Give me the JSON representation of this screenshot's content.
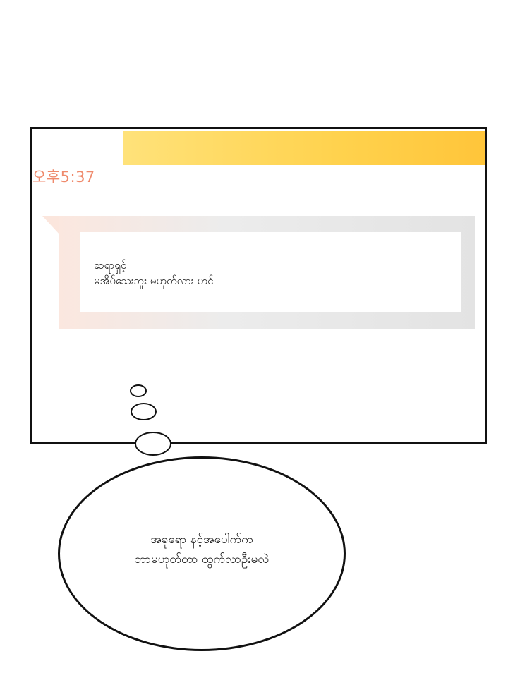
{
  "chat_panel": {
    "time": "오후5:37",
    "message_lines": [
      "ဆရာရှင့်",
      "မအိပ်သေးဘူး မဟုတ်လား ဟင်"
    ]
  },
  "thought": {
    "lines": [
      "အခုရော နင့်အပေါက်က",
      "ဘာမဟုတ်တာ ထွက်လာဦးမလဲ"
    ]
  },
  "colors": {
    "time": "#ef8a6c",
    "top_bar": "#ffd24d",
    "outline": "#111111"
  }
}
